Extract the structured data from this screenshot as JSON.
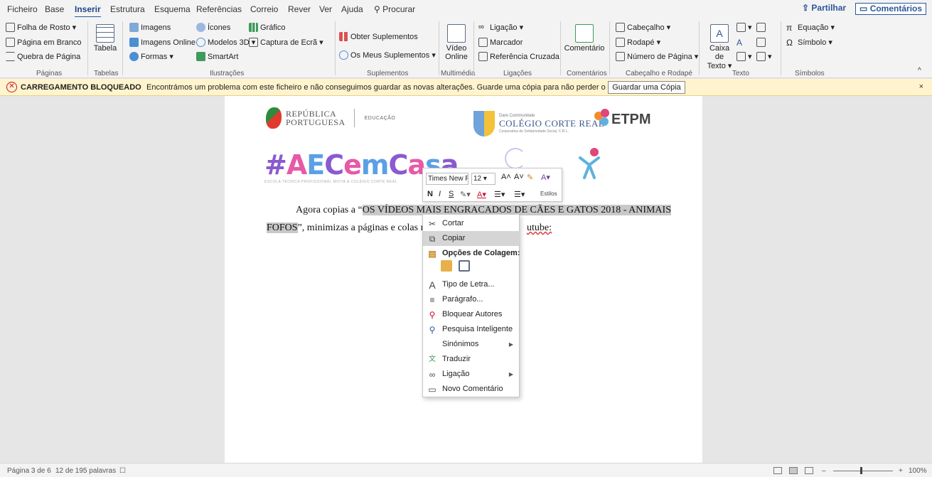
{
  "menu": {
    "tabs": [
      "Ficheiro",
      "Base",
      "Inserir",
      "Estrutura",
      "Esquema",
      "Referências",
      "Correio",
      "Rever",
      "Ver",
      "Ajuda",
      "Procurar"
    ],
    "active_tab": "Inserir",
    "share_label": "Partilhar",
    "comments_label": "Comentários"
  },
  "ribbon": {
    "paginas": {
      "items": [
        "Folha de Rosto ▾",
        "Página em Branco",
        "Quebra de Página"
      ],
      "label": "Páginas"
    },
    "tabelas": {
      "button": "Tabela",
      "label": "Tabelas"
    },
    "ilustracoes": {
      "items": [
        "Imagens",
        "Imagens Online",
        "Formas ▾",
        "Ícones",
        "Modelos 3D ▾",
        "SmartArt",
        "Gráfico",
        "Captura de Ecrã ▾"
      ],
      "label": "Ilustrações"
    },
    "suplementos": {
      "items": [
        "Obter Suplementos",
        "Os Meus Suplementos ▾"
      ],
      "label": "Suplementos"
    },
    "multimedia": {
      "button_line1": "Vídeo",
      "button_line2": "Online",
      "label": "Multimédia"
    },
    "ligacoes": {
      "items": [
        "Ligação ▾",
        "Marcador",
        "Referência Cruzada"
      ],
      "label": "Ligações"
    },
    "comentarios": {
      "button": "Comentário",
      "label": "Comentários"
    },
    "cabecalho": {
      "items": [
        "Cabeçalho ▾",
        "Rodapé ▾",
        "Número de Página ▾"
      ],
      "label": "Cabeçalho e Rodapé"
    },
    "texto": {
      "button_line1": "Caixa de",
      "button_line2": "Texto ▾",
      "label": "Texto"
    },
    "simbolos": {
      "items": [
        "Equação ▾",
        "Símbolo ▾"
      ],
      "label": "Símbolos"
    }
  },
  "warning": {
    "title": "CARREGAMENTO BLOQUEADO",
    "message": "Encontrámos um problema com este ficheiro e não conseguimos guardar as novas alterações. Guarde uma cópia para não perder o seu trabalho.",
    "button": "Guardar uma Cópia",
    "close": "×"
  },
  "document": {
    "logo_republica_line1": "REPÚBLICA",
    "logo_republica_line2": "PORTUGUESA",
    "logo_educacao": "EDUCAÇÃO",
    "logo_college_small": "Dare Communitate",
    "logo_college_name": "COLÉGIO CORTE REAL",
    "logo_college_sub": "Cooperativa de Solidariedade Social, C.R.L.",
    "logo_etpm": "ETPM",
    "banner_text": "#AECemCasa",
    "banner_sub": "ESCOLA TÉCNICA PROFISSIONAL MOITA & COLÉGIO CORTE REAL",
    "para_indent_text": "Agora copias a “",
    "para_highlight1": "OS VÍDEOS MAIS ENGRACADOS DE CÃES E GATOS 2018 - ANIMAIS",
    "para_highlight2": "FOFOS",
    "para_line2_rest": "”, minimizas a páginas e colas n",
    "para_line2_end": "utube:"
  },
  "mini_toolbar": {
    "font": "Times New F",
    "size": "12",
    "bold": "N",
    "italic": "I",
    "underline": "S",
    "styles": "Estilos"
  },
  "context_menu": {
    "items": [
      {
        "label": "Cortar",
        "icon": "scissors-icon",
        "glyph": "✂"
      },
      {
        "label": "Copiar",
        "icon": "copy-icon",
        "glyph": "⧉"
      },
      {
        "label": "Opções de Colagem:",
        "icon": "paste-icon",
        "glyph": "📋"
      },
      {
        "label": "Tipo de Letra...",
        "icon": "font-icon",
        "glyph": "A"
      },
      {
        "label": "Parágrafo...",
        "icon": "paragraph-icon",
        "glyph": "≡"
      },
      {
        "label": "Bloquear Autores",
        "icon": "block-authors-icon",
        "glyph": "⚲"
      },
      {
        "label": "Pesquisa Inteligente",
        "icon": "smart-search-icon",
        "glyph": "⚲"
      },
      {
        "label": "Sinónimos",
        "icon": "",
        "glyph": ""
      },
      {
        "label": "Traduzir",
        "icon": "translate-icon",
        "glyph": "文"
      },
      {
        "label": "Ligação",
        "icon": "link-icon",
        "glyph": "∞"
      },
      {
        "label": "Novo Comentário",
        "icon": "new-comment-icon",
        "glyph": "▭"
      }
    ]
  },
  "status": {
    "page": "Página 3 de 6",
    "words": "12 de 195 palavras",
    "zoom_minus": "–",
    "zoom_plus": "+",
    "zoom": "100%"
  },
  "colors": {
    "accent": "#2b579a",
    "warning_bg": "#fff4ce",
    "aec_purple": "#8a5ad0",
    "aec_pink": "#e65aa8",
    "aec_blue": "#5aa0e6"
  }
}
